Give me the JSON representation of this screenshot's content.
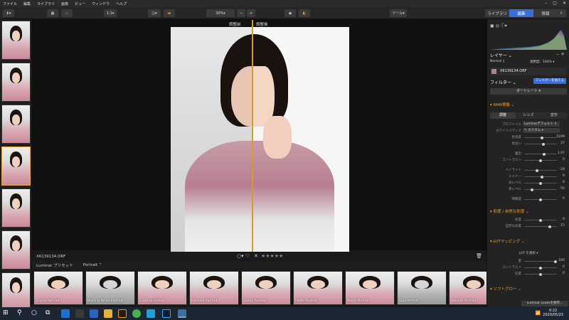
{
  "menu": [
    "ファイル",
    "編集",
    "ライブラリ",
    "画像",
    "ビュー",
    "ウィンドウ",
    "ヘルプ"
  ],
  "toolbar": {
    "aspect": "1:1",
    "zoom": "30%",
    "tools_label": "ツール",
    "modes": [
      "ライブラリ",
      "編集",
      "情報"
    ],
    "active_mode": "編集"
  },
  "canvas": {
    "before_label": "調整前",
    "after_label": "調整後"
  },
  "status": {
    "filename": "X6139134.ORF",
    "rating_stars": 5
  },
  "presets": {
    "category": "Luminar プリセット",
    "subcategory": "Portrait",
    "items": [
      "Classic Portrait",
      "Black & White Portrait",
      "Glowing Portrait",
      "Delicate Portrait",
      "Sunny Portrait",
      "Matte Portrait",
      "Warm Portrait",
      "Cool Portrait",
      "Smooth Portrait"
    ]
  },
  "right": {
    "layers_label": "レイヤー",
    "blend_mode": "Normal",
    "opacity": "透明度：100% ▾",
    "layer_name": "X6139134.ORF",
    "filters_label": "フィルター",
    "add_filter": "フィルターを加える",
    "workspace": "ポートレート",
    "raw_section": "RAW現像",
    "raw_tabs": [
      "調整",
      "レンズ",
      "変形"
    ],
    "profile_label": "プロファイル",
    "profile_value": "Luminarデフォルト",
    "wb_label": "ホワイトバランス",
    "wb_value": "カスタム",
    "sliders": [
      {
        "label": "色温度",
        "value": "5109",
        "pos": 0.55
      },
      {
        "label": "色合い",
        "value": "27",
        "pos": 0.6
      },
      {
        "label": "露出",
        "value": "1.07",
        "pos": 0.62
      },
      {
        "label": "コントラスト",
        "value": "0",
        "pos": 0.5
      },
      {
        "label": "ハイライト",
        "value": "-24",
        "pos": 0.38
      },
      {
        "label": "シャドー",
        "value": "9",
        "pos": 0.55
      },
      {
        "label": "白レベル",
        "value": "0",
        "pos": 0.5
      },
      {
        "label": "黒レベル",
        "value": "-55",
        "pos": 0.22
      },
      {
        "label": "明瞭度",
        "value": "0",
        "pos": 0.5
      }
    ],
    "saturation_section": "彩度 / 自然な彩度",
    "sat_sliders": [
      {
        "label": "彩度",
        "value": "0",
        "pos": 0.5
      },
      {
        "label": "自然な彩度",
        "value": "57",
        "pos": 0.8
      }
    ],
    "lut_section": "LUTマッピング",
    "lut_select": "LUT を選択",
    "lut_sliders": [
      {
        "label": "量",
        "value": "100",
        "pos": 1.0
      },
      {
        "label": "コントラスト",
        "value": "0",
        "pos": 0.5
      },
      {
        "label": "彩度",
        "value": "0",
        "pos": 0.5
      }
    ],
    "softglow_section": "ソフトグロー",
    "looks_button": "Luminar Looksを保存..."
  },
  "taskbar": {
    "time": "0:22",
    "date": "2020/05/23"
  },
  "colors": {
    "accent": "#e8a23a",
    "active_blue": "#3b6fd8"
  }
}
